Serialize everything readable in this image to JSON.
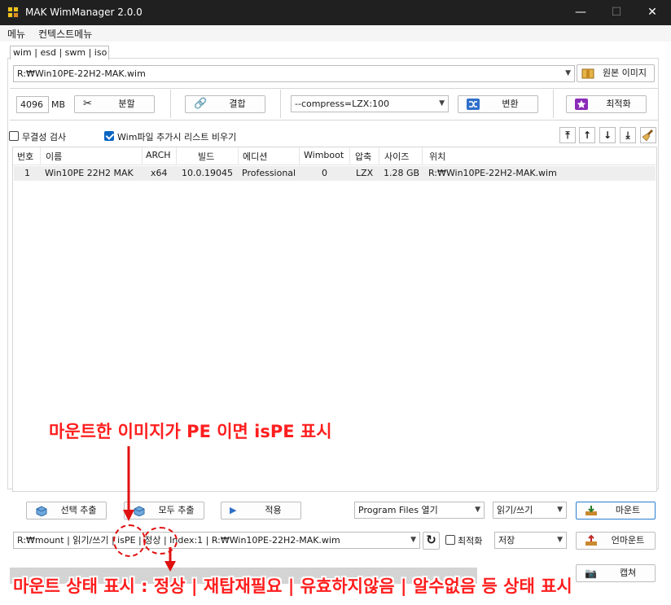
{
  "window": {
    "title": "MAK WimManager 2.0.0"
  },
  "menu": [
    "메뉴",
    "컨텍스트메뉴"
  ],
  "tab_label": "wim | esd | swm | iso",
  "source": {
    "path": "R:₩Win10PE-22H2-MAK.wim",
    "button": "원본 이미지"
  },
  "toolbar": {
    "split_size": "4096",
    "split_unit": "MB",
    "split_button": "분할",
    "merge_button": "결합",
    "compress_option": "--compress=LZX:100",
    "convert_button": "변환",
    "optimize_button": "최적화"
  },
  "options": {
    "integrity_check": {
      "label": "무결성 검사",
      "checked": false
    },
    "clear_list": {
      "label": "Wim파일 추가시 리스트 비우기",
      "checked": true
    }
  },
  "list": {
    "columns": [
      "번호",
      "이름",
      "ARCH",
      "빌드",
      "에디션",
      "Wimboot",
      "압축",
      "사이즈",
      "위치"
    ],
    "rows": [
      [
        "1",
        "Win10PE 22H2 MAK",
        "x64",
        "10.0.19045",
        "Professional",
        "0",
        "LZX",
        "1.28 GB",
        "R:₩Win10PE-22H2-MAK.wim"
      ]
    ]
  },
  "actions": {
    "extract_selected": "선택 추출",
    "extract_all": "모두 추출",
    "apply": "적용",
    "open_folder": "Program Files 열기",
    "mode": "읽기/쓰기",
    "mount": "마운트"
  },
  "mount_status": {
    "info": "R:₩mount | 읽기/쓰기 | isPE | 정상 | Index:1 | R:₩Win10PE-22H2-MAK.wim",
    "optimize_label": "최적화",
    "save_mode": "저장",
    "unmount": "언마운트",
    "capture": "캡쳐"
  },
  "annotations": {
    "ispe_note": "마운트한 이미지가 PE 이면 isPE 표시",
    "status_note": "마운트 상태 표시 : 정상 | 재탑재필요 | 유효하지않음 | 알수없음 등 상태 표시"
  },
  "colors": {
    "titlebar": "#202020",
    "accent": "#0a64c2",
    "annotation": "#ff1e1e"
  }
}
